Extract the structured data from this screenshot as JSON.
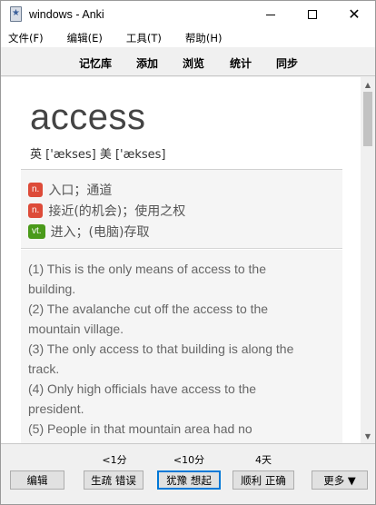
{
  "window": {
    "title": "windows - Anki",
    "minimize_glyph": "",
    "close_glyph": "✕"
  },
  "menu": {
    "items": [
      "文件(F)",
      "编辑(E)",
      "工具(T)",
      "帮助(H)"
    ]
  },
  "toolbar": {
    "items": [
      "记忆库",
      "添加",
      "浏览",
      "统计",
      "同步"
    ]
  },
  "card": {
    "word": "access",
    "phonetic": "英 ['ækses] 美 ['ækses]",
    "definitions": [
      {
        "pos": "n.",
        "text": "入口；通道",
        "color": "#dd4b39"
      },
      {
        "pos": "n.",
        "text": "接近(的机会)；使用之权",
        "color": "#dd4b39"
      },
      {
        "pos": "vt.",
        "text": "进入；(电脑)存取",
        "color": "#4a9a1a"
      }
    ],
    "examples": [
      "(1) This is the only means of access to the",
      "building.",
      "(2) The avalanche cut off the access to the",
      "mountain village.",
      "(3) The only access to that building is along the",
      "track.",
      "(4) Only high officials have access to the",
      "president.",
      "(5) People in that mountain area had no"
    ]
  },
  "review": {
    "intervals": [
      "<1分",
      "<10分",
      "4天"
    ],
    "edit_label": "编辑",
    "buttons": [
      "生疏 错误",
      "犹豫 想起",
      "顺利 正确"
    ],
    "more_label": "更多 ▼"
  },
  "colors": {
    "accent": "#0078d7",
    "badge_noun": "#dd4b39",
    "badge_verb": "#4a9a1a"
  }
}
